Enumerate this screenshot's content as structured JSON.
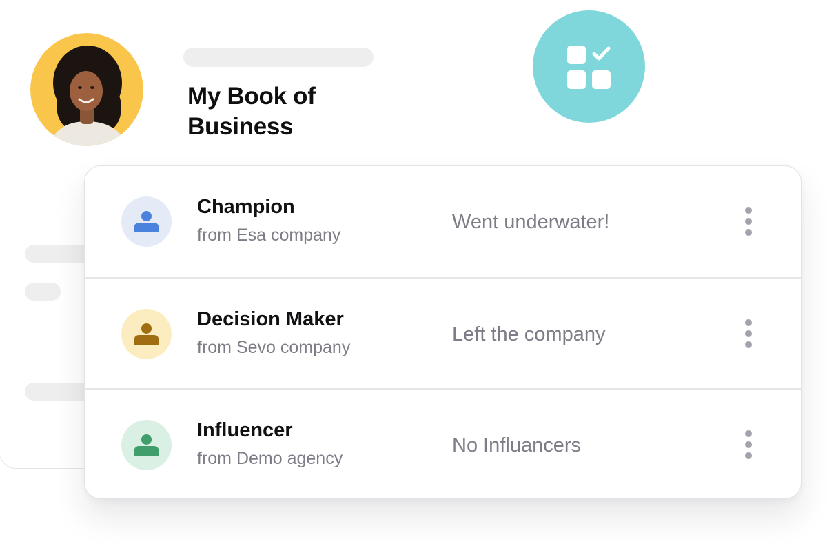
{
  "header": {
    "title": "My Book of Business",
    "avatar_icon": "user-portrait",
    "badge_icon": "grid-check-icon"
  },
  "colors": {
    "avatar_bg": "#f9c54a",
    "badge_bg": "#7fd7dc",
    "skeleton": "#eeeeee",
    "text_primary": "#111114",
    "text_secondary": "#7c7d86"
  },
  "contacts": [
    {
      "role": "Champion",
      "from": "from Esa company",
      "status": "Went underwater!",
      "icon": "person-icon",
      "icon_bg": "#e4ebf7",
      "icon_color": "#4b82de"
    },
    {
      "role": "Decision Maker",
      "from": "from Sevo company",
      "status": "Left the company",
      "icon": "person-icon",
      "icon_bg": "#fcedc1",
      "icon_color": "#a06d10"
    },
    {
      "role": "Influencer",
      "from": "from Demo agency",
      "status": "No Influancers",
      "icon": "person-icon",
      "icon_bg": "#dbf0e4",
      "icon_color": "#3f9e6b"
    }
  ]
}
